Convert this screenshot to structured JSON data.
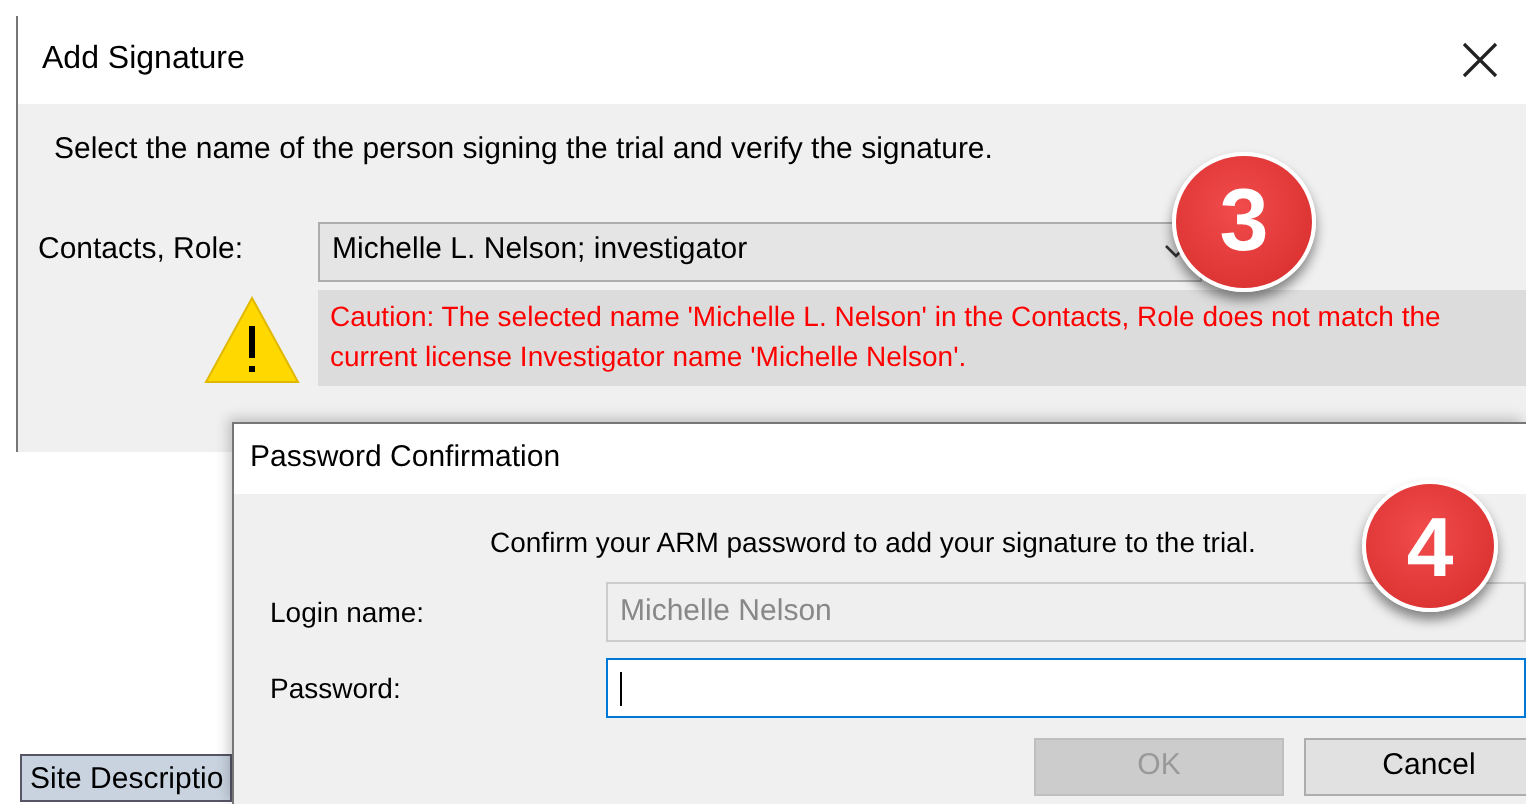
{
  "background": {
    "label": "Site Descriptio"
  },
  "add_signature": {
    "title": "Add Signature",
    "instruction": "Select the name of the person signing the trial and verify the signature.",
    "contacts_role": {
      "label": "Contacts, Role:",
      "value": "Michelle L. Nelson; investigator"
    },
    "caution": "Caution: The selected name 'Michelle L. Nelson' in the Contacts, Role does not match the current license Investigator name 'Michelle Nelson'.",
    "callout": "3"
  },
  "password_confirmation": {
    "title": "Password Confirmation",
    "instruction": "Confirm your ARM password to add your signature to the trial.",
    "fields": [
      {
        "label": "Login name:",
        "value": "Michelle Nelson",
        "disabled": true,
        "focused": false
      },
      {
        "label": "Password:",
        "disabled": false,
        "focused": true
      }
    ],
    "buttons": [
      {
        "label": "OK",
        "disabled": true
      },
      {
        "label": "Cancel",
        "disabled": false
      }
    ],
    "callout": "4"
  }
}
